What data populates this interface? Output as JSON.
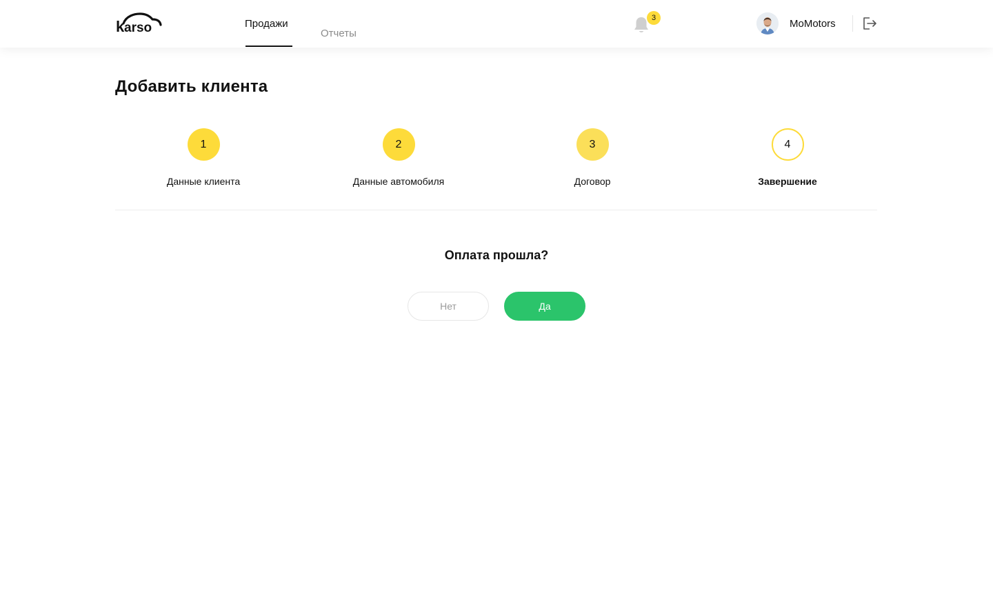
{
  "header": {
    "logo_text": "karso",
    "nav": {
      "sales": "Продажи",
      "reports": "Отчеты"
    },
    "notifications_count": "3",
    "username": "MoMotors"
  },
  "main": {
    "title": "Добавить клиента",
    "steps": [
      {
        "number": "1",
        "label": "Данные клиента",
        "state": "completed"
      },
      {
        "number": "2",
        "label": "Данные автомобиля",
        "state": "completed"
      },
      {
        "number": "3",
        "label": "Договор",
        "state": "completed"
      },
      {
        "number": "4",
        "label": "Завершение",
        "state": "current"
      }
    ],
    "question": "Оплата прошла?",
    "buttons": {
      "no": "Нет",
      "yes": "Да"
    }
  },
  "colors": {
    "accent_yellow": "#FDDB3A",
    "success_green": "#2BC46B",
    "text": "#111111",
    "muted": "#8a8a8a"
  },
  "icons": [
    "karso-logo",
    "bell-icon",
    "avatar",
    "logout-icon"
  ]
}
